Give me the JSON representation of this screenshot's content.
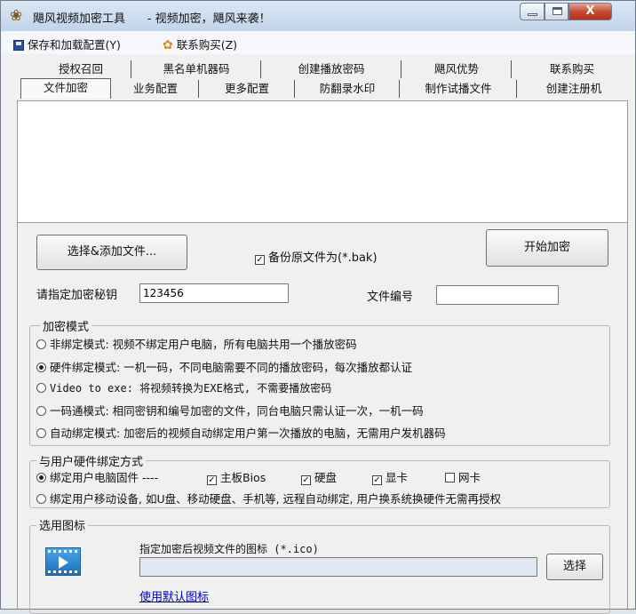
{
  "window": {
    "app_name": "飓风视频加密工具",
    "subtitle": "- 视频加密，飓风来袭！",
    "close_glyph": "X"
  },
  "menu": {
    "save_load": "保存和加载配置(Y)",
    "contact_buy": "联系购买(Z)"
  },
  "tabs": {
    "row1": [
      "授权召回",
      "黑名单机器码",
      "创建播放密码",
      "飓风优势",
      "联系购买"
    ],
    "row2": [
      "文件加密",
      "业务配置",
      "更多配置",
      "防翻录水印",
      "制作试播文件",
      "创建注册机"
    ],
    "active": "文件加密"
  },
  "file_panel": {
    "select_button": "选择&添加文件...",
    "backup_checked": true,
    "backup_label": "备份原文件为(*.bak)",
    "start_button": "开始加密",
    "key_label": "请指定加密秘钥",
    "key_value": "123456",
    "file_no_label": "文件编号",
    "file_no_value": ""
  },
  "encrypt_mode": {
    "title": "加密模式",
    "selected_index": 1,
    "options": [
      "非绑定模式: 视频不绑定用户电脑，所有电脑共用一个播放密码",
      "硬件绑定模式: 一机一码，不同电脑需要不同的播放密码，每次播放都认证",
      "Video to exe: 将视频转换为EXE格式, 不需要播放密码",
      "一码通模式: 相同密钥和编号加密的文件，同台电脑只需认证一次，一机一码",
      "自动绑定模式: 加密后的视频自动绑定用户第一次播放的电脑，无需用户发机器码"
    ]
  },
  "hardware_binding": {
    "title": "与用户硬件绑定方式",
    "option1": "绑定用户电脑固件 ----",
    "option1_selected": true,
    "checks": [
      {
        "label": "主板Bios",
        "checked": true
      },
      {
        "label": "硬盘",
        "checked": true
      },
      {
        "label": "显卡",
        "checked": true
      },
      {
        "label": "网卡",
        "checked": false
      }
    ],
    "option2": "绑定用户移动设备, 如U盘、移动硬盘、手机等, 远程自动绑定, 用户换系统换硬件无需再授权",
    "option2_selected": false
  },
  "icon_section": {
    "title": "选用图标",
    "prompt": "指定加密后视频文件的图标 (*.ico)",
    "path_value": "",
    "choose_button": "选择",
    "default_link": "使用默认图标"
  }
}
